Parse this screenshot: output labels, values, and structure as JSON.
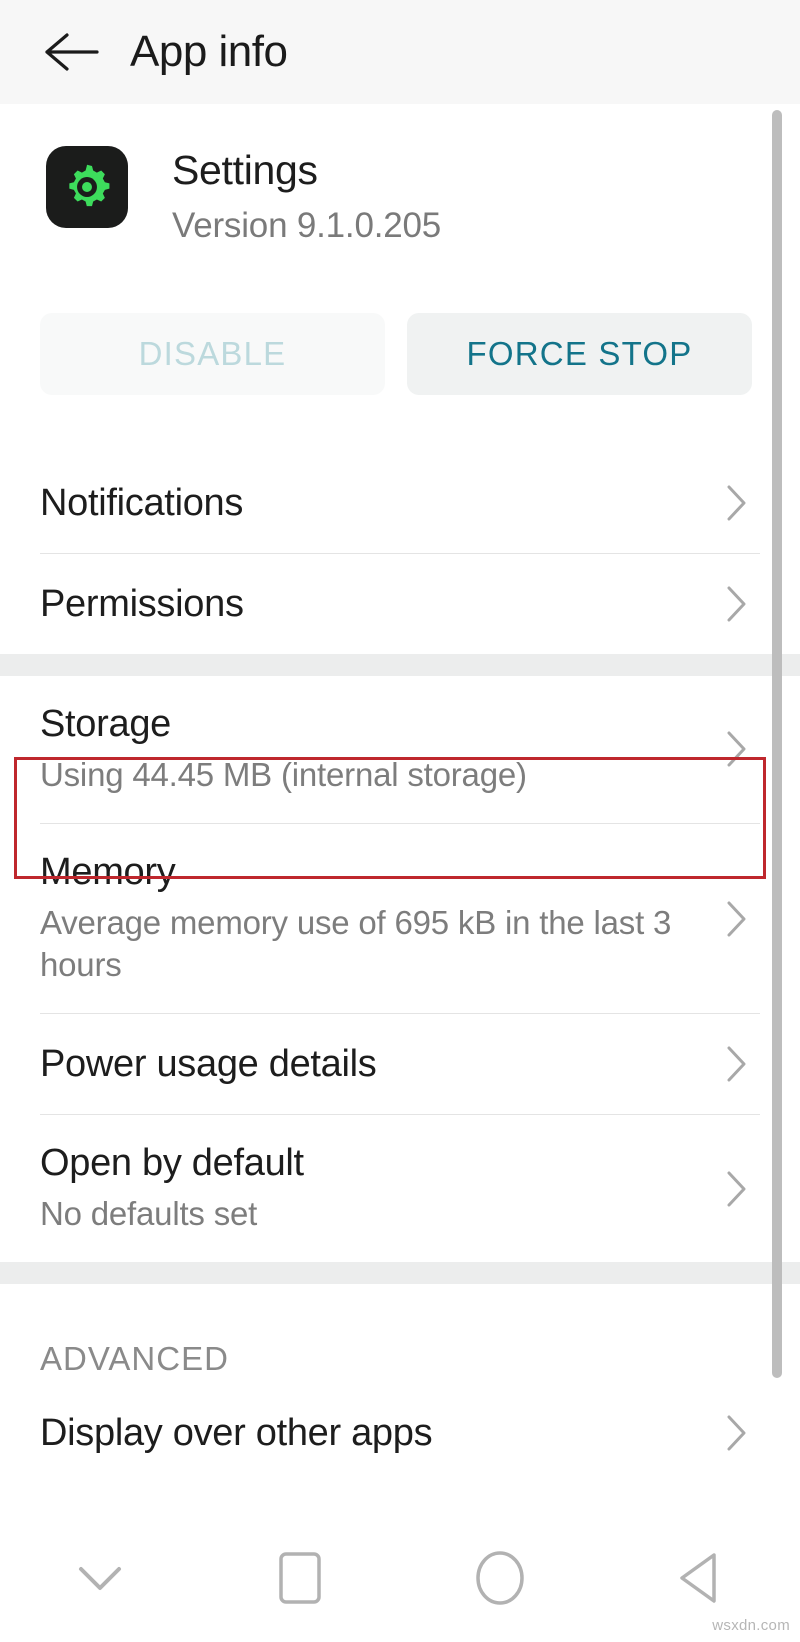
{
  "appbar": {
    "title": "App info",
    "back_icon": "arrow-left-icon"
  },
  "app": {
    "icon": "settings-gear-icon",
    "icon_bg": "#1b1c1b",
    "icon_fg": "#3ddc5c",
    "name": "Settings",
    "version": "Version 9.1.0.205"
  },
  "actions": [
    {
      "label": "DISABLE",
      "state": "disabled",
      "color": "#bcd9dd"
    },
    {
      "label": "FORCE STOP",
      "state": "enabled",
      "color": "#13748a"
    }
  ],
  "list": {
    "group1": [
      {
        "title": "Notifications",
        "sub": ""
      },
      {
        "title": "Permissions",
        "sub": ""
      }
    ],
    "group2": [
      {
        "title": "Storage",
        "sub": "Using 44.45 MB (internal storage)",
        "highlighted": true
      },
      {
        "title": "Memory",
        "sub": "Average memory use of 695 kB in the last 3 hours"
      },
      {
        "title": "Power usage details",
        "sub": ""
      },
      {
        "title": "Open by default",
        "sub": "No defaults set"
      }
    ],
    "advanced_label": "ADVANCED",
    "group3": [
      {
        "title": "Display over other apps",
        "sub": ""
      }
    ]
  },
  "highlight": {
    "target": "Storage",
    "color": "#bf272d"
  },
  "navbar": {
    "buttons": [
      {
        "icon": "chevron-down-icon",
        "name": "hide-keyboard"
      },
      {
        "icon": "square-icon",
        "name": "recents"
      },
      {
        "icon": "circle-icon",
        "name": "home"
      },
      {
        "icon": "triangle-left-icon",
        "name": "back"
      }
    ]
  },
  "watermark": "wsxdn.com"
}
